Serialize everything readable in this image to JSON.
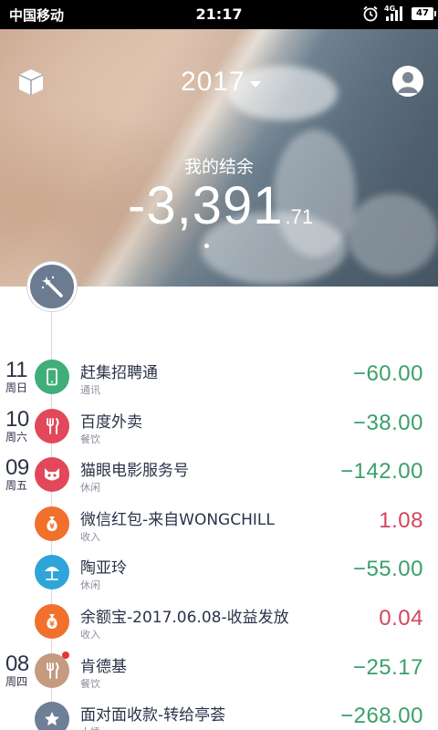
{
  "status_bar": {
    "carrier": "中国移动",
    "time": "21:17",
    "network": "4G",
    "battery": "47"
  },
  "header": {
    "year": "2017",
    "balance_label": "我的结余",
    "balance_main": "-3,391",
    "balance_cents": ".71",
    "left_icon": "cube-icon",
    "right_icon": "avatar-icon"
  },
  "fab_icon": "magic-wand-icon",
  "colors": {
    "expense": "#3aa06a",
    "income": "#d4455c",
    "timeline_fab": "#6c7b90"
  },
  "transactions": [
    {
      "day": "11",
      "weekday": "周日",
      "title": "赶集招聘通",
      "category": "通讯",
      "amount": "−60.00",
      "type": "expense",
      "icon": "phone-icon",
      "icon_color": "#3fae78",
      "badge": false
    },
    {
      "day": "10",
      "weekday": "周六",
      "title": "百度外卖",
      "category": "餐饮",
      "amount": "−38.00",
      "type": "expense",
      "icon": "fork-knife-icon",
      "icon_color": "#e2475a",
      "badge": false
    },
    {
      "day": "09",
      "weekday": "周五",
      "title": "猫眼电影服务号",
      "category": "休闲",
      "amount": "−142.00",
      "type": "expense",
      "icon": "cat-icon",
      "icon_color": "#e2475a",
      "badge": false
    },
    {
      "day": "",
      "weekday": "",
      "title": "微信红包-来自WONGCHILL",
      "category": "收入",
      "amount": "1.08",
      "type": "income",
      "icon": "money-bag-icon",
      "icon_color": "#f0702c",
      "badge": false
    },
    {
      "day": "",
      "weekday": "",
      "title": "陶亚玲",
      "category": "休闲",
      "amount": "−55.00",
      "type": "expense",
      "icon": "beach-umbrella-icon",
      "icon_color": "#2fa4d8",
      "badge": false
    },
    {
      "day": "",
      "weekday": "",
      "title": "余额宝-2017.06.08-收益发放",
      "category": "收入",
      "amount": "0.04",
      "type": "income",
      "icon": "money-bag-icon",
      "icon_color": "#f0702c",
      "badge": false
    },
    {
      "day": "08",
      "weekday": "周四",
      "title": "肯德基",
      "category": "餐饮",
      "amount": "−25.17",
      "type": "expense",
      "icon": "fork-knife-icon",
      "icon_color": "#c49a80",
      "badge": true
    },
    {
      "day": "",
      "weekday": "",
      "title": "面对面收款-转给亭荟",
      "category": "人情",
      "amount": "−268.00",
      "type": "expense",
      "icon": "star-icon",
      "icon_color": "#6f7f95",
      "badge": false
    }
  ]
}
